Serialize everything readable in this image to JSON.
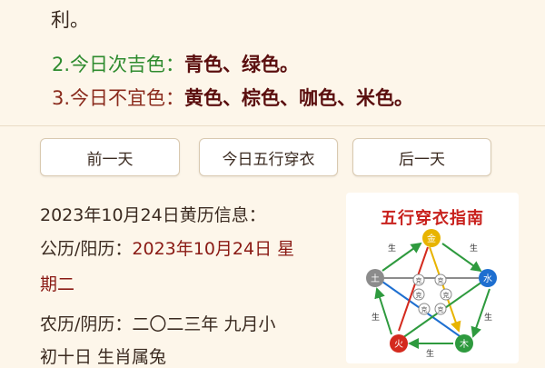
{
  "advice": {
    "line1_tail": "利。",
    "line2_num": "2.",
    "line2_label": "今日次吉色：",
    "line2_colors": "青色、绿色。",
    "line3_num": "3.",
    "line3_label": "今日不宜色：",
    "line3_colors": "黄色、棕色、咖色、米色。"
  },
  "nav": {
    "prev": "前一天",
    "today": "今日五行穿衣",
    "next": "后一天"
  },
  "info": {
    "heading": "2023年10月24日黄历信息：",
    "gregorian_label": "公历/阳历：",
    "gregorian_value": "2023年10月24日 星",
    "weekday": "期二",
    "lunar_label": "农历/阴历：",
    "lunar_value": "二〇二三年 九月小",
    "lunar_day": "初十日 生肖属兔"
  },
  "wuxing": {
    "title": "五行穿衣指南",
    "elements": [
      "金",
      "水",
      "木",
      "火",
      "土"
    ],
    "sheng_label": "生",
    "ke_label": "克",
    "colors": {
      "metal": "#e8b400",
      "water": "#1e6fd0",
      "wood": "#2e9a3e",
      "fire": "#d42a1e",
      "earth": "#8c8c8c",
      "arrow_green": "#2e9a3e",
      "arrow_yellow": "#e8b400"
    }
  }
}
